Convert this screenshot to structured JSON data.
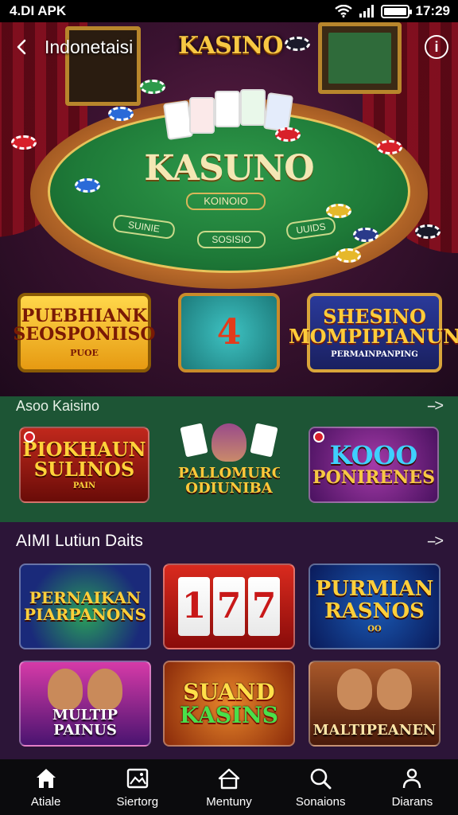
{
  "status_bar": {
    "left_text": "4.DI APK",
    "time": "17:29",
    "battery_level": 1.0
  },
  "header": {
    "region": "Indonetaisi",
    "logo": "KASINO",
    "info_icon": "info-icon"
  },
  "hero": {
    "felt_title": "KASUNO",
    "felt_sub": "KOINOIO",
    "felt_box_left": "SUINIE",
    "felt_box_center": "SOSISIO",
    "felt_box_right": "UUIDS"
  },
  "features": [
    {
      "title": "PUEBHIANK SEOSPONIISO",
      "sub": "PUOE"
    },
    {
      "title": "4"
    },
    {
      "title": "SHESINO MOMPIPIANUN",
      "sub": "PERMAINPANPING"
    }
  ],
  "section_1": {
    "title": "Asoo Kaisino",
    "more": "-->",
    "tiles": [
      {
        "title": "PIOKHAUN SULINOS",
        "sub": "PAIN"
      },
      {
        "title": "PALLOMURG ODIUNIBA"
      },
      {
        "title_top": "KOOO",
        "title": "PONIRENES"
      }
    ]
  },
  "section_2": {
    "title": "AIMI Lutiun Daits",
    "more": "-->",
    "tiles": [
      {
        "title": "PERNAIKAN PIARPANONS"
      },
      {
        "title": "177"
      },
      {
        "title": "PURMIAN RASNOS",
        "sub": "OO"
      },
      {
        "title": "MULTIP PAINUS"
      },
      {
        "title": "SUAND",
        "title2": "KASINS"
      },
      {
        "title": "MALTIPEANEN"
      }
    ]
  },
  "bottom_nav": [
    {
      "label": "Atiale",
      "icon": "home-icon"
    },
    {
      "label": "Siertorg",
      "icon": "image-icon"
    },
    {
      "label": "Mentuny",
      "icon": "house-outline-icon"
    },
    {
      "label": "Sonaions",
      "icon": "search-icon"
    },
    {
      "label": "Diarans",
      "icon": "person-icon"
    }
  ],
  "colors": {
    "accent": "#f7c844",
    "section_green": "#1d5535",
    "section_purple": "#2c1538",
    "nav_bg": "#0b0b0d"
  }
}
